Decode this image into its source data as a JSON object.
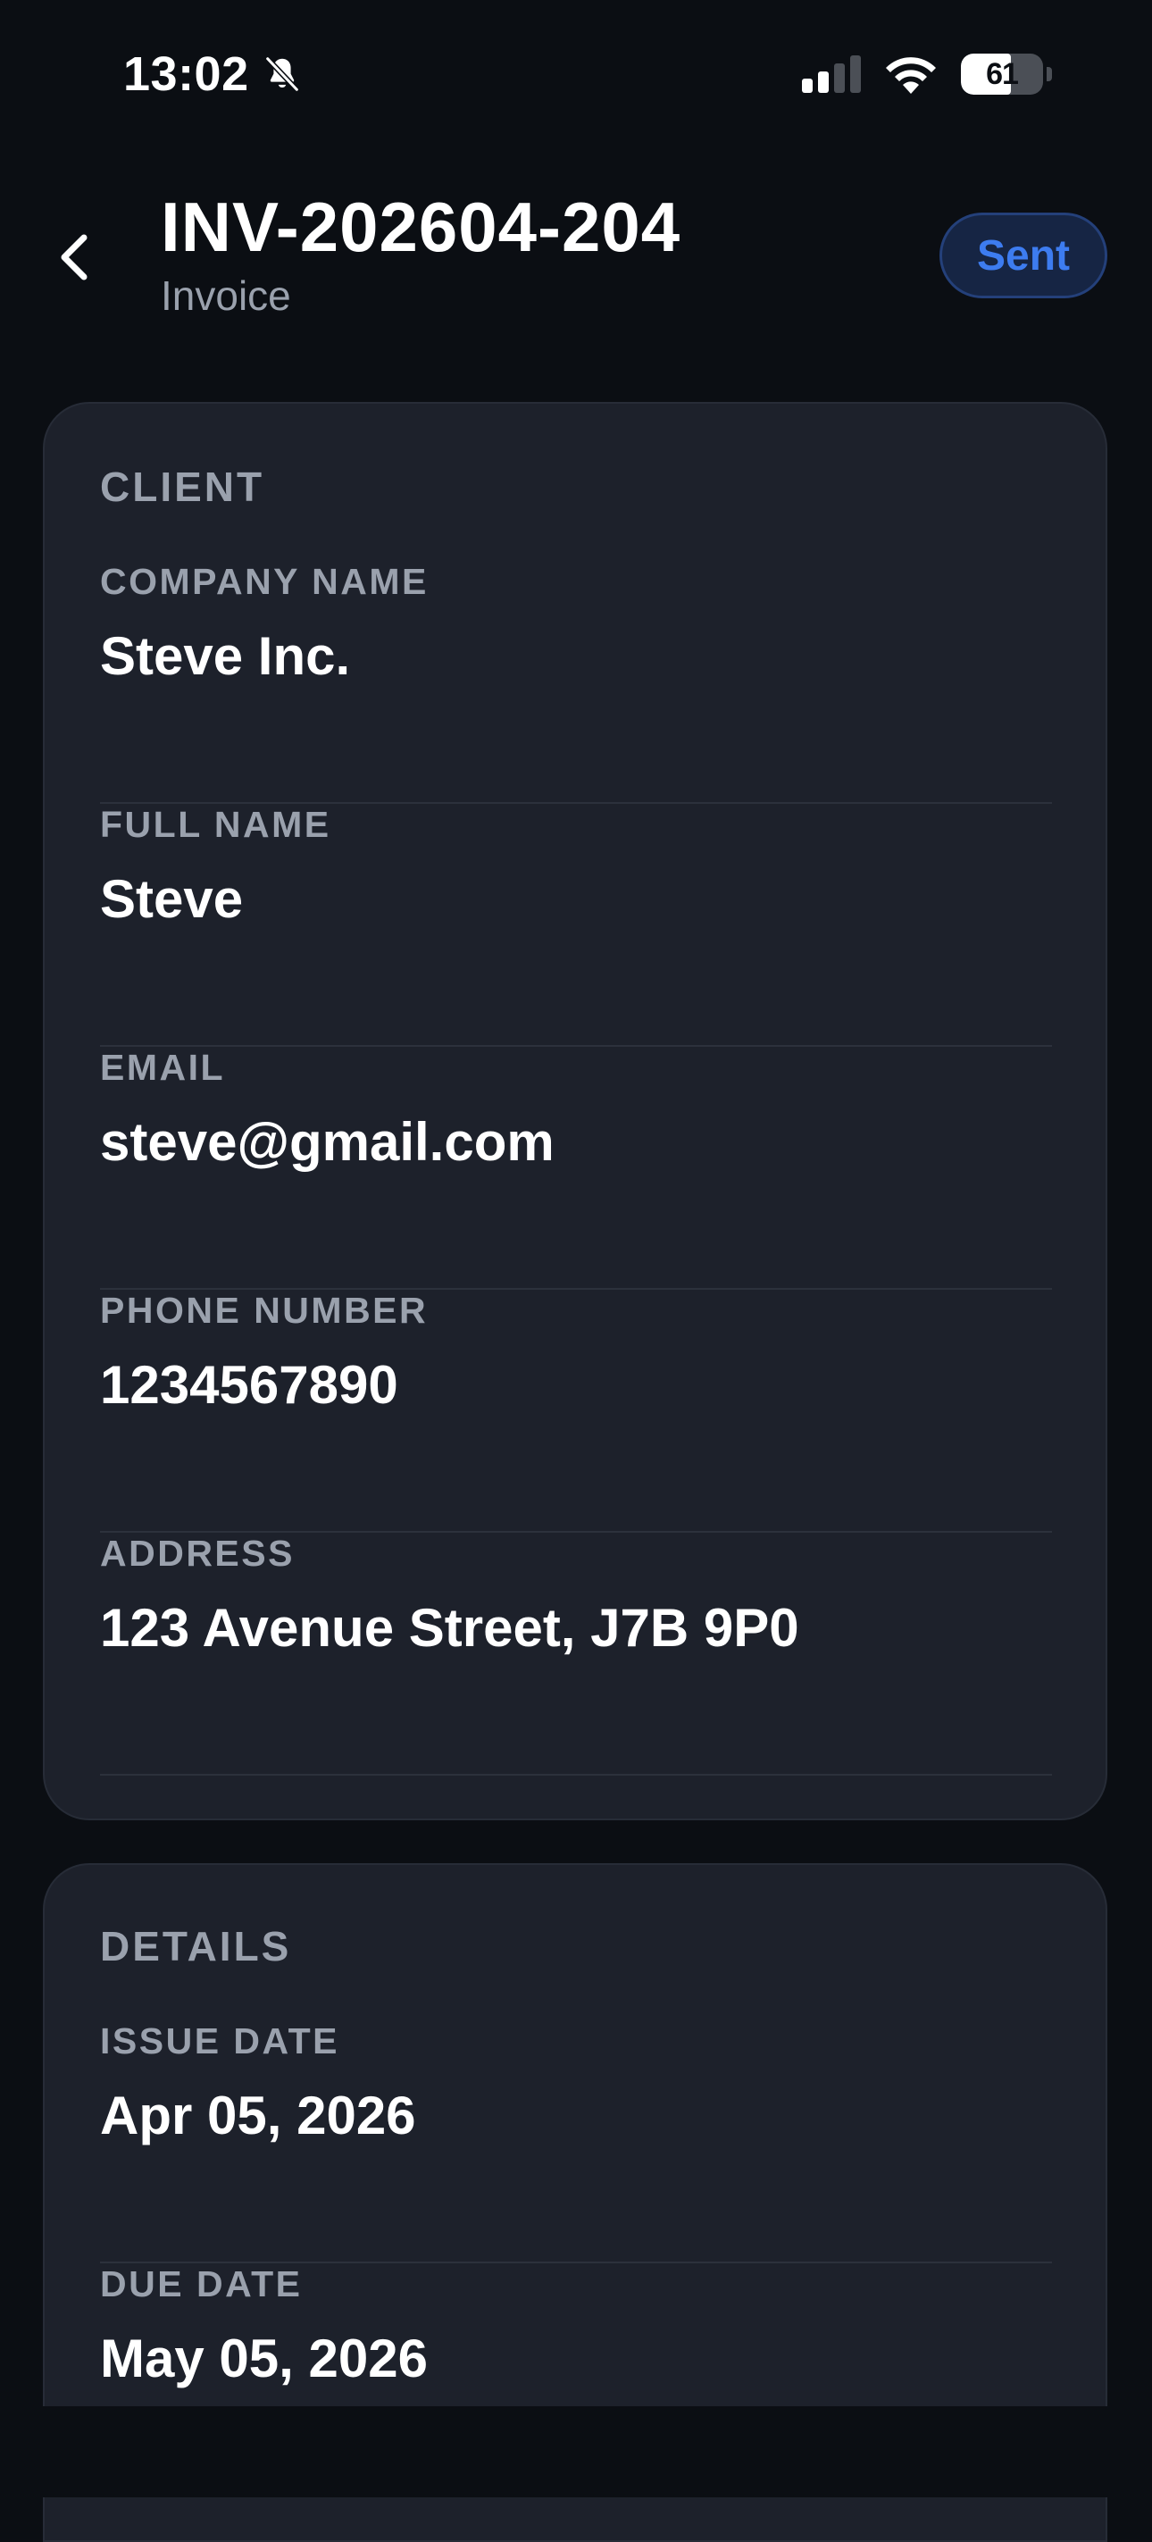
{
  "status_bar": {
    "time": "13:02",
    "battery": "61",
    "battery_level": 0.61
  },
  "header": {
    "title": "INV-202604-204",
    "subtitle": "Invoice",
    "status": "Sent"
  },
  "client": {
    "section_title": "CLIENT",
    "fields": [
      {
        "label": "COMPANY NAME",
        "value": "Steve Inc."
      },
      {
        "label": "FULL NAME",
        "value": "Steve"
      },
      {
        "label": "EMAIL",
        "value": "steve@gmail.com"
      },
      {
        "label": "PHONE NUMBER",
        "value": "1234567890"
      },
      {
        "label": "ADDRESS",
        "value": "123 Avenue Street, J7B 9P0"
      }
    ]
  },
  "details": {
    "section_title": "DETAILS",
    "fields": [
      {
        "label": "ISSUE DATE",
        "value": "Apr 05, 2026"
      },
      {
        "label": "DUE DATE",
        "value": "May 05, 2026"
      }
    ]
  },
  "icons": {
    "bell": "bell-slash-icon",
    "signal": "cellular-signal-icon",
    "wifi": "wifi-icon",
    "battery": "battery-icon",
    "back": "chevron-left-icon"
  },
  "colors": {
    "background": "#0b0e13",
    "card": "#1d212b",
    "accent": "#3d7cf0",
    "muted_text": "#9aa1ad"
  }
}
